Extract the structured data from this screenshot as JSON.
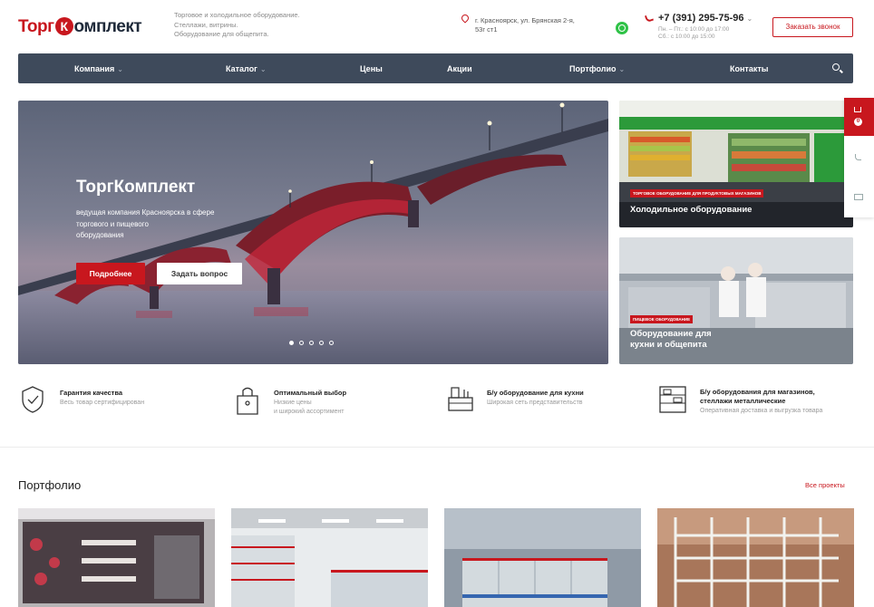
{
  "header": {
    "logo_left": "Торг",
    "logo_mark": "К",
    "logo_right": "омплект",
    "tagline_1": "Торговое и холодильное оборудование.",
    "tagline_2": "Стеллажи, витрины.",
    "tagline_3": "Оборудование для общепита.",
    "address_1": "г. Красноярск, ул. Брянская 2-я,",
    "address_2": "53г ст1",
    "phone": "+7 (391) 295-75-96",
    "phone_chevron": "⌄",
    "hours_1": "Пн. – Пт.: с 10:00 до 17:00",
    "hours_2": "Сб.: с 10:00 до 15:00",
    "callback_label": "Заказать звонок"
  },
  "nav": {
    "items": [
      {
        "label": "Компания",
        "dropdown": true
      },
      {
        "label": "Каталог",
        "dropdown": true
      },
      {
        "label": "Цены",
        "dropdown": false
      },
      {
        "label": "Акции",
        "dropdown": false
      },
      {
        "label": "Портфолио",
        "dropdown": true
      },
      {
        "label": "Контакты",
        "dropdown": false
      }
    ],
    "chevron": "⌄"
  },
  "hero": {
    "title": "ТоргКомплект",
    "subtitle_1": "ведущая компания Красноярска в сфере",
    "subtitle_2": "торгового и пищевого",
    "subtitle_3": "оборудования",
    "btn_more": "Подробнее",
    "btn_ask": "Задать вопрос",
    "slides_total": 5,
    "slide_active": 1
  },
  "banners": [
    {
      "tag": "ТОРГОВОЕ ОБОРУДОВАНИЕ ДЛЯ ПРОДУКТОВЫХ МАГАЗИНОВ",
      "title": "Холодильное оборудование"
    },
    {
      "tag": "ПИЩЕВОЕ ОБОРУДОВАНИЕ",
      "title_1": "Оборудование для",
      "title_2": "кухни и общепита"
    }
  ],
  "float_panel": {
    "cart_count": "0"
  },
  "features": [
    {
      "title": "Гарантия качества",
      "desc_1": "Весь товар сертифицирован",
      "icon": "shield-check-icon"
    },
    {
      "title": "Оптимальный выбор",
      "desc_1": "Низкие цены",
      "desc_2": "и широкий ассортимент",
      "icon": "tag-icon"
    },
    {
      "title": "Б/у оборудование для кухни",
      "desc_1": "Широкая сеть представительств",
      "icon": "kitchen-icon"
    },
    {
      "title_1": "Б/у оборудования для магазинов,",
      "title_2": "стеллажи металлические",
      "desc_1": "Оперативная доставка и выгрузка товара",
      "icon": "shelving-icon"
    }
  ],
  "portfolio": {
    "title": "Портфолио",
    "all_projects": "Все проекты"
  },
  "colors": {
    "accent": "#c8171e",
    "nav_bg": "#3e4a5b"
  }
}
